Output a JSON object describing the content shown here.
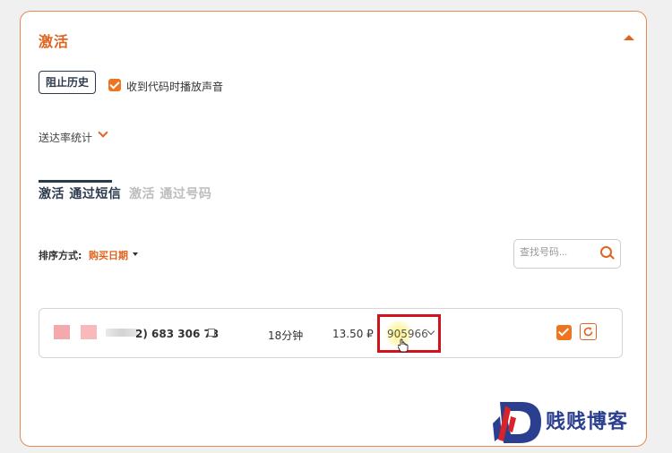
{
  "card": {
    "title": "激活"
  },
  "controls": {
    "history_button": "阻止历史",
    "sound_checkbox_label": "收到代码时播放声音",
    "sound_checked": true
  },
  "stats": {
    "label": "送达率统计"
  },
  "tabs": [
    {
      "label": "激活 通过短信",
      "active": true
    },
    {
      "label": "激活 通过号码",
      "active": false
    }
  ],
  "sort": {
    "label": "排序方式:",
    "value": "购买日期"
  },
  "search": {
    "placeholder": "查找号码..."
  },
  "activation_row": {
    "phone_visible": "2) 683 306 73",
    "duration": "18分钟",
    "price": "13.50 ₽",
    "code": "905966",
    "done_checked": true
  },
  "watermark": {
    "text": "贱贱博客"
  },
  "colors": {
    "accent": "#e0641f",
    "checkbox": "#ee7422",
    "navy": "#2c3a4e",
    "highlight_border": "#d0131d",
    "watermark": "#2a3f8f"
  }
}
